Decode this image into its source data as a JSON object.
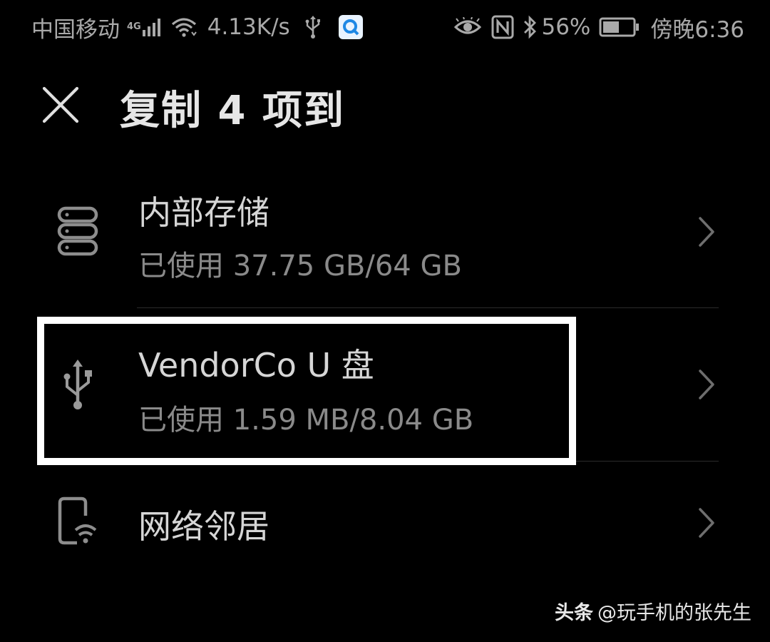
{
  "status_bar": {
    "carrier": "中国移动",
    "network_type": "4G",
    "net_speed": "4.13K/s",
    "battery_percent": "56%",
    "battery_level": 0.56,
    "time": "傍晚6:36",
    "icons": [
      "signal-icon",
      "wifi-icon",
      "usb-icon",
      "browser-app-icon",
      "eye-comfort-icon",
      "nfc-icon",
      "bluetooth-icon",
      "battery-icon"
    ]
  },
  "header": {
    "title": "复制 4 项到",
    "close_icon": "close-icon"
  },
  "storage_list": [
    {
      "icon": "internal-storage-icon",
      "title": "内部存储",
      "usage": "已使用 37.75 GB/64 GB"
    },
    {
      "icon": "usb-icon",
      "title": "VendorCo U 盘",
      "usage": "已使用 1.59 MB/8.04 GB"
    },
    {
      "icon": "network-neighborhood-icon",
      "title": "网络邻居",
      "usage": ""
    }
  ],
  "watermark": {
    "brand": "头条",
    "author": "@玩手机的张先生"
  },
  "colors": {
    "background": "#000000",
    "text_primary": "#d6d6d6",
    "text_secondary": "#8a8a8a",
    "highlight_border": "#ffffff"
  }
}
